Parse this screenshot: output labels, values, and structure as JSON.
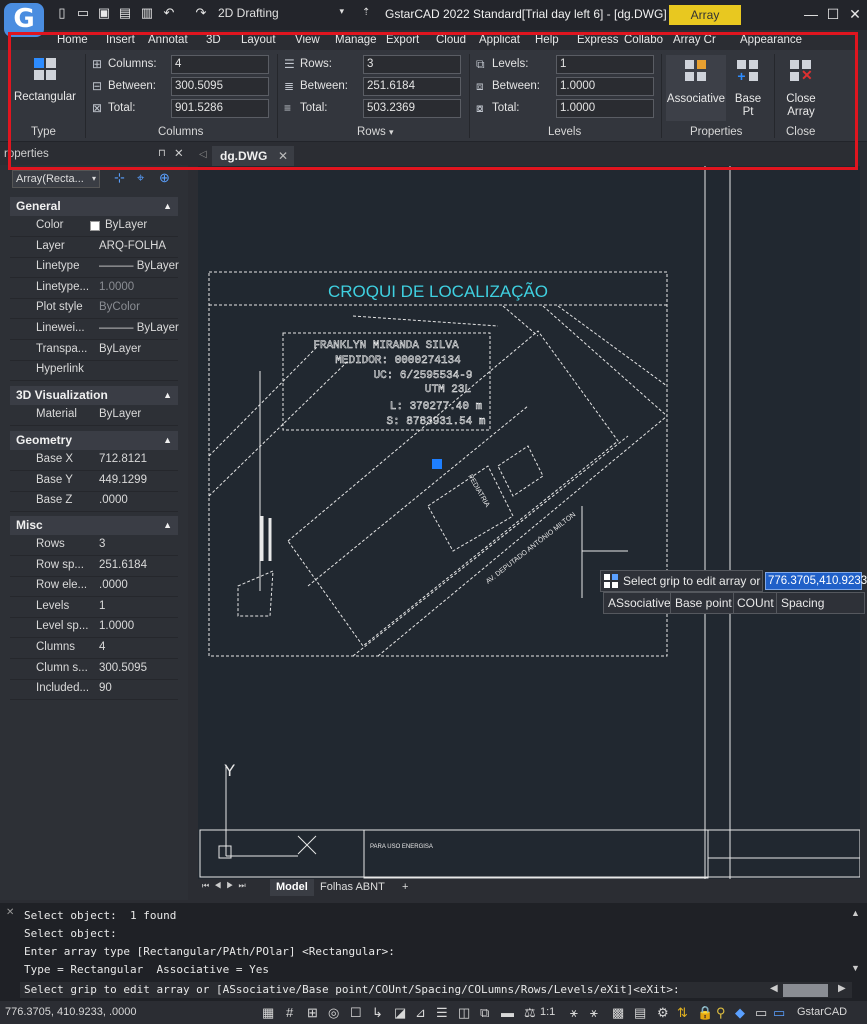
{
  "titlebar": {
    "logo": "G",
    "workspace": "2D Drafting",
    "app_title": "GstarCAD 2022 Standard[Trial day left 6] - [dg.DWG]",
    "context_tab": "Array Creation"
  },
  "ribbon_tabs": [
    "Home",
    "Insert",
    "Annotat",
    "3D",
    "Layout",
    "View",
    "Manage",
    "Export",
    "Cloud",
    "Applicat",
    "Help",
    "Express",
    "Collabo",
    "Array Cr",
    "Appearance"
  ],
  "ribbon": {
    "type": {
      "button": "Rectangular",
      "group": "Type"
    },
    "columns": {
      "group": "Columns",
      "columns_label": "Columns:",
      "columns_value": "4",
      "between_label": "Between:",
      "between_value": "300.5095",
      "total_label": "Total:",
      "total_value": "901.5286"
    },
    "rows": {
      "group": "Rows",
      "rows_label": "Rows:",
      "rows_value": "3",
      "between_label": "Between:",
      "between_value": "251.6184",
      "total_label": "Total:",
      "total_value": "503.2369"
    },
    "levels": {
      "group": "Levels",
      "levels_label": "Levels:",
      "levels_value": "1",
      "between_label": "Between:",
      "between_value": "1.0000",
      "total_label": "Total:",
      "total_value": "1.0000"
    },
    "properties": {
      "group": "Properties",
      "associative": "Associative",
      "base_pt_1": "Base",
      "base_pt_2": "Pt"
    },
    "close": {
      "group": "Close",
      "close_1": "Close",
      "close_2": "Array"
    }
  },
  "doc_tab": "dg.DWG",
  "properties_panel": {
    "header": "roperties",
    "object_select": "Array(Recta...",
    "sections": {
      "general": "General",
      "vis3d": "3D Visualization",
      "geometry": "Geometry",
      "misc": "Misc"
    },
    "general": [
      {
        "k": "Color",
        "v": "ByLayer"
      },
      {
        "k": "Layer",
        "v": "ARQ-FOLHA"
      },
      {
        "k": "Linetype",
        "v": "——— ByLayer"
      },
      {
        "k": "Linetype...",
        "v": "1.0000"
      },
      {
        "k": "Plot style",
        "v": "ByColor"
      },
      {
        "k": "Linewei...",
        "v": "——— ByLayer"
      },
      {
        "k": "Transpa...",
        "v": "ByLayer"
      },
      {
        "k": "Hyperlink",
        "v": ""
      }
    ],
    "vis3d": [
      {
        "k": "Material",
        "v": "ByLayer"
      }
    ],
    "geometry": [
      {
        "k": "Base X",
        "v": "712.8121"
      },
      {
        "k": "Base Y",
        "v": "449.1299"
      },
      {
        "k": "Base Z",
        "v": ".0000"
      }
    ],
    "misc": [
      {
        "k": "Rows",
        "v": "3"
      },
      {
        "k": "Row sp...",
        "v": "251.6184"
      },
      {
        "k": "Row ele...",
        "v": ".0000"
      },
      {
        "k": "Levels",
        "v": "1"
      },
      {
        "k": "Level sp...",
        "v": "1.0000"
      },
      {
        "k": "Clumns",
        "v": "4"
      },
      {
        "k": "Clumn s...",
        "v": "300.5095"
      },
      {
        "k": "Included...",
        "v": "90"
      }
    ]
  },
  "drawing": {
    "title": "CROQUI DE LOCALIZAÇÃO",
    "info_lines": [
      "FRANKLYN MIRANDA SILVA",
      "MEDIDOR: 0000274134",
      "UC: 6/2595534-9",
      "UTM 23L",
      "L: 370277.40 m",
      "S: 8783931.54 m"
    ],
    "label_ped": "PEDIATRIA",
    "label_rua": "AV. DEPUTADO ANTÔNIO MILTON",
    "label_box": "PARA USO ENERGISA",
    "ucs_y": "Y"
  },
  "tooltip": {
    "prompt": "Select grip to edit array or",
    "coord_value": "776.3705,410.9233",
    "options": [
      "ASsociative",
      "Base point",
      "COUnt",
      "Spacing"
    ]
  },
  "layout_tabs": [
    "Model",
    "Folhas ABNT",
    "+"
  ],
  "command_history": [
    "Select object:  1 found",
    "Select object:",
    "Enter array type [Rectangular/PAth/POlar] <Rectangular>:",
    "Type = Rectangular  Associative = Yes"
  ],
  "command_prompt": "Select grip to edit array or [ASsociative/Base point/COUnt/Spacing/COLumns/Rows/Levels/eXit]<eXit>:",
  "status": {
    "coords": "776.3705, 410.9233, .0000",
    "scale": "1:1",
    "app": "GstarCAD"
  },
  "colors": {
    "accent_red": "#e0151f",
    "ctx_tab": "#e8c820",
    "grip": "#1e7fff",
    "title_cyan": "#3fd0e0"
  }
}
